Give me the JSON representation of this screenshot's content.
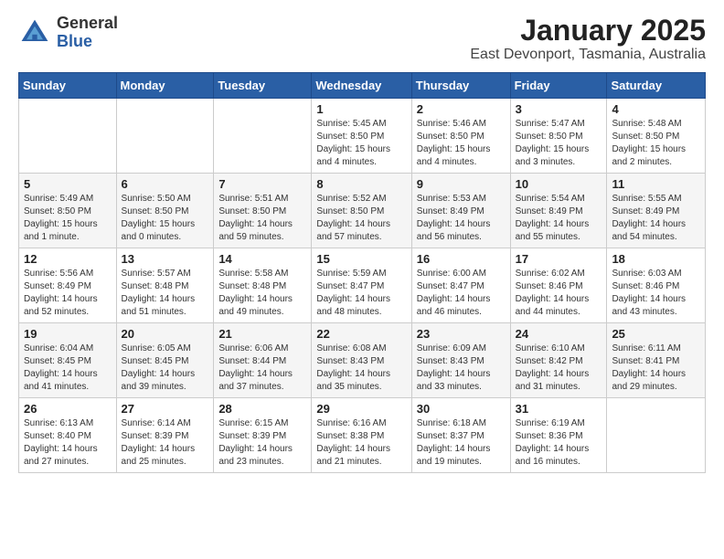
{
  "logo": {
    "general": "General",
    "blue": "Blue"
  },
  "title": "January 2025",
  "subtitle": "East Devonport, Tasmania, Australia",
  "days_of_week": [
    "Sunday",
    "Monday",
    "Tuesday",
    "Wednesday",
    "Thursday",
    "Friday",
    "Saturday"
  ],
  "weeks": [
    [
      {
        "day": "",
        "info": ""
      },
      {
        "day": "",
        "info": ""
      },
      {
        "day": "",
        "info": ""
      },
      {
        "day": "1",
        "info": "Sunrise: 5:45 AM\nSunset: 8:50 PM\nDaylight: 15 hours\nand 4 minutes."
      },
      {
        "day": "2",
        "info": "Sunrise: 5:46 AM\nSunset: 8:50 PM\nDaylight: 15 hours\nand 4 minutes."
      },
      {
        "day": "3",
        "info": "Sunrise: 5:47 AM\nSunset: 8:50 PM\nDaylight: 15 hours\nand 3 minutes."
      },
      {
        "day": "4",
        "info": "Sunrise: 5:48 AM\nSunset: 8:50 PM\nDaylight: 15 hours\nand 2 minutes."
      }
    ],
    [
      {
        "day": "5",
        "info": "Sunrise: 5:49 AM\nSunset: 8:50 PM\nDaylight: 15 hours\nand 1 minute."
      },
      {
        "day": "6",
        "info": "Sunrise: 5:50 AM\nSunset: 8:50 PM\nDaylight: 15 hours\nand 0 minutes."
      },
      {
        "day": "7",
        "info": "Sunrise: 5:51 AM\nSunset: 8:50 PM\nDaylight: 14 hours\nand 59 minutes."
      },
      {
        "day": "8",
        "info": "Sunrise: 5:52 AM\nSunset: 8:50 PM\nDaylight: 14 hours\nand 57 minutes."
      },
      {
        "day": "9",
        "info": "Sunrise: 5:53 AM\nSunset: 8:49 PM\nDaylight: 14 hours\nand 56 minutes."
      },
      {
        "day": "10",
        "info": "Sunrise: 5:54 AM\nSunset: 8:49 PM\nDaylight: 14 hours\nand 55 minutes."
      },
      {
        "day": "11",
        "info": "Sunrise: 5:55 AM\nSunset: 8:49 PM\nDaylight: 14 hours\nand 54 minutes."
      }
    ],
    [
      {
        "day": "12",
        "info": "Sunrise: 5:56 AM\nSunset: 8:49 PM\nDaylight: 14 hours\nand 52 minutes."
      },
      {
        "day": "13",
        "info": "Sunrise: 5:57 AM\nSunset: 8:48 PM\nDaylight: 14 hours\nand 51 minutes."
      },
      {
        "day": "14",
        "info": "Sunrise: 5:58 AM\nSunset: 8:48 PM\nDaylight: 14 hours\nand 49 minutes."
      },
      {
        "day": "15",
        "info": "Sunrise: 5:59 AM\nSunset: 8:47 PM\nDaylight: 14 hours\nand 48 minutes."
      },
      {
        "day": "16",
        "info": "Sunrise: 6:00 AM\nSunset: 8:47 PM\nDaylight: 14 hours\nand 46 minutes."
      },
      {
        "day": "17",
        "info": "Sunrise: 6:02 AM\nSunset: 8:46 PM\nDaylight: 14 hours\nand 44 minutes."
      },
      {
        "day": "18",
        "info": "Sunrise: 6:03 AM\nSunset: 8:46 PM\nDaylight: 14 hours\nand 43 minutes."
      }
    ],
    [
      {
        "day": "19",
        "info": "Sunrise: 6:04 AM\nSunset: 8:45 PM\nDaylight: 14 hours\nand 41 minutes."
      },
      {
        "day": "20",
        "info": "Sunrise: 6:05 AM\nSunset: 8:45 PM\nDaylight: 14 hours\nand 39 minutes."
      },
      {
        "day": "21",
        "info": "Sunrise: 6:06 AM\nSunset: 8:44 PM\nDaylight: 14 hours\nand 37 minutes."
      },
      {
        "day": "22",
        "info": "Sunrise: 6:08 AM\nSunset: 8:43 PM\nDaylight: 14 hours\nand 35 minutes."
      },
      {
        "day": "23",
        "info": "Sunrise: 6:09 AM\nSunset: 8:43 PM\nDaylight: 14 hours\nand 33 minutes."
      },
      {
        "day": "24",
        "info": "Sunrise: 6:10 AM\nSunset: 8:42 PM\nDaylight: 14 hours\nand 31 minutes."
      },
      {
        "day": "25",
        "info": "Sunrise: 6:11 AM\nSunset: 8:41 PM\nDaylight: 14 hours\nand 29 minutes."
      }
    ],
    [
      {
        "day": "26",
        "info": "Sunrise: 6:13 AM\nSunset: 8:40 PM\nDaylight: 14 hours\nand 27 minutes."
      },
      {
        "day": "27",
        "info": "Sunrise: 6:14 AM\nSunset: 8:39 PM\nDaylight: 14 hours\nand 25 minutes."
      },
      {
        "day": "28",
        "info": "Sunrise: 6:15 AM\nSunset: 8:39 PM\nDaylight: 14 hours\nand 23 minutes."
      },
      {
        "day": "29",
        "info": "Sunrise: 6:16 AM\nSunset: 8:38 PM\nDaylight: 14 hours\nand 21 minutes."
      },
      {
        "day": "30",
        "info": "Sunrise: 6:18 AM\nSunset: 8:37 PM\nDaylight: 14 hours\nand 19 minutes."
      },
      {
        "day": "31",
        "info": "Sunrise: 6:19 AM\nSunset: 8:36 PM\nDaylight: 14 hours\nand 16 minutes."
      },
      {
        "day": "",
        "info": ""
      }
    ]
  ]
}
